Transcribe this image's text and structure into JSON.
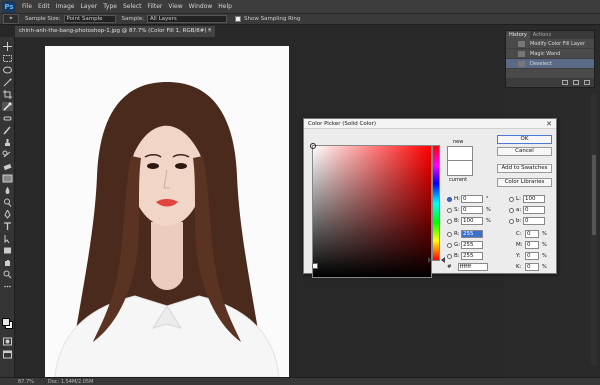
{
  "menu": {
    "logo": "Ps",
    "items": [
      "File",
      "Edit",
      "Image",
      "Layer",
      "Type",
      "Select",
      "Filter",
      "View",
      "Window",
      "Help"
    ]
  },
  "options": {
    "tool_glyph": "⌖",
    "sample_size_label": "Sample Size:",
    "sample_size_value": "Point Sample",
    "sample_label": "Sample:",
    "sample_value": "All Layers",
    "show_ring_label": "Show Sampling Ring"
  },
  "document": {
    "tab_title": "chinh-anh-the-bang-photoshop-1.jpg @ 87.7% (Color Fill 1, RGB/8#) *",
    "close_glyph": "×"
  },
  "status": {
    "zoom": "87.7%",
    "doc": "Doc: 1.54M/2.05M"
  },
  "history": {
    "tabs": [
      "History",
      "Actions"
    ],
    "items": [
      {
        "label": "Modify Color Fill Layer",
        "selected": false
      },
      {
        "label": "Magic Wand",
        "selected": false
      },
      {
        "label": "Deselect",
        "selected": true
      }
    ]
  },
  "color_picker": {
    "title": "Color Picker (Solid Color)",
    "close_glyph": "✕",
    "new_label": "new",
    "current_label": "current",
    "buttons": {
      "ok": "OK",
      "cancel": "Cancel",
      "add_swatches": "Add to Swatches",
      "libraries": "Color Libraries"
    },
    "only_web_label": "Only Web Colors",
    "new_color": "#ffffff",
    "current_color": "#ffffff",
    "hsb": {
      "H": {
        "label": "H:",
        "value": "0",
        "unit": "°"
      },
      "S": {
        "label": "S:",
        "value": "0",
        "unit": "%"
      },
      "B": {
        "label": "B:",
        "value": "100",
        "unit": "%"
      }
    },
    "rgb": {
      "R": {
        "label": "R:",
        "value": "255"
      },
      "G": {
        "label": "G:",
        "value": "255"
      },
      "B": {
        "label": "B:",
        "value": "255"
      }
    },
    "lab": {
      "L": {
        "label": "L:",
        "value": "100"
      },
      "a": {
        "label": "a:",
        "value": "0"
      },
      "b": {
        "label": "b:",
        "value": "0"
      }
    },
    "cmyk": {
      "C": {
        "label": "C:",
        "value": "0",
        "unit": "%"
      },
      "M": {
        "label": "M:",
        "value": "0",
        "unit": "%"
      },
      "Y": {
        "label": "Y:",
        "value": "0",
        "unit": "%"
      },
      "K": {
        "label": "K:",
        "value": "0",
        "unit": "%"
      }
    },
    "hex": {
      "label": "#",
      "value": "ffffff"
    }
  },
  "colors": {
    "accent": "#3b6fd0",
    "hair": "#4a2a1c",
    "skin": "#f1d6c8",
    "shirt": "#f6f6f6"
  }
}
